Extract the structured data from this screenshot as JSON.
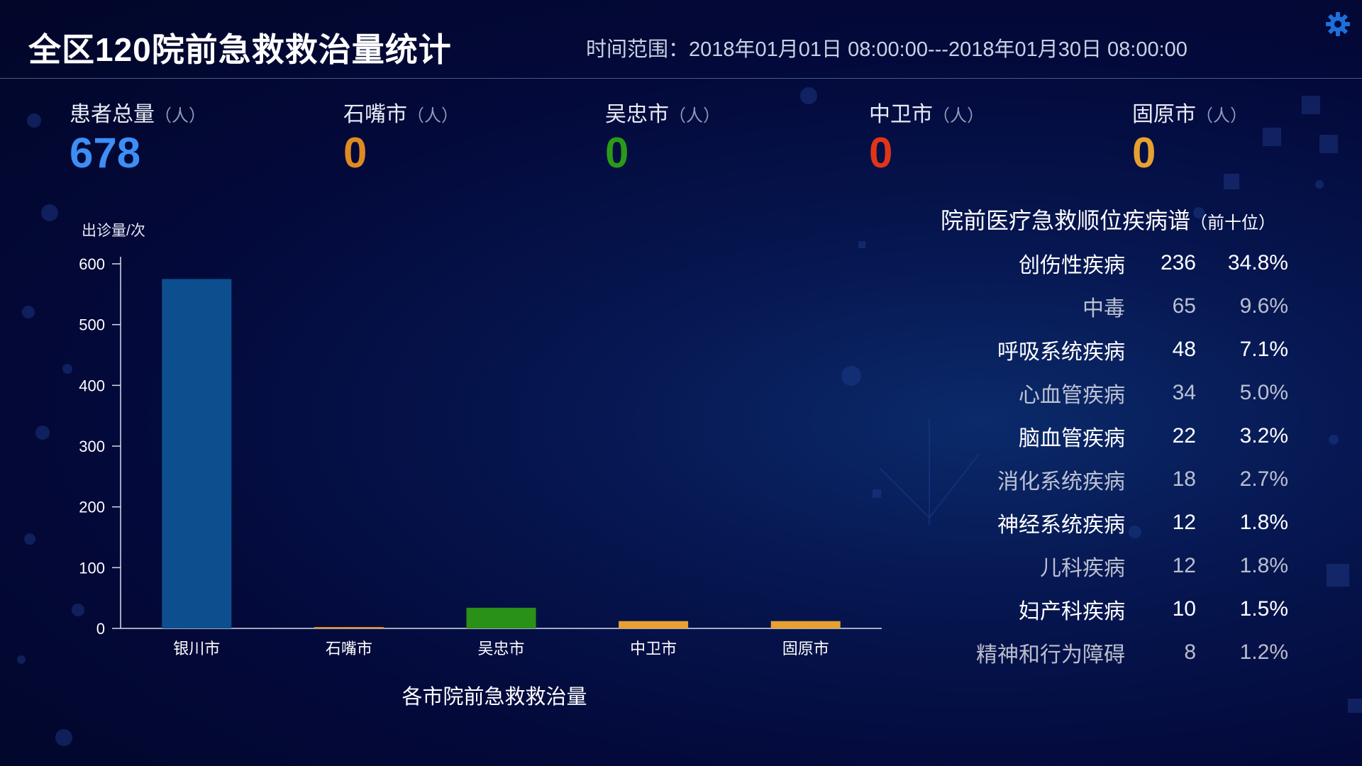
{
  "header": {
    "title": "全区120院前急救救治量统计",
    "time_range": "时间范围：2018年01月01日 08:00:00---2018年01月30日 08:00:00",
    "settings_icon": "gear-icon",
    "settings_color": "#1e6fd9"
  },
  "stats": [
    {
      "label": "患者总量",
      "unit": "（人）",
      "value": "678",
      "color": "#3d8ef5"
    },
    {
      "label": "石嘴市",
      "unit": "（人）",
      "value": "0",
      "color": "#e08a22"
    },
    {
      "label": "吴忠市",
      "unit": "（人）",
      "value": "0",
      "color": "#2a9a18"
    },
    {
      "label": "中卫市",
      "unit": "（人）",
      "value": "0",
      "color": "#e03518"
    },
    {
      "label": "固原市",
      "unit": "（人）",
      "value": "0",
      "color": "#e8a030"
    }
  ],
  "chart_data": {
    "type": "bar",
    "title": "各市院前急救救治量",
    "xlabel": "",
    "ylabel": "出诊量/次",
    "categories": [
      "银川市",
      "石嘴市",
      "吴忠市",
      "中卫市",
      "固原市"
    ],
    "values": [
      575,
      2,
      34,
      12,
      12
    ],
    "colors": [
      "#0d4f8e",
      "#e08a22",
      "#2a9018",
      "#e8a030",
      "#e8a030"
    ],
    "ylim": [
      0,
      600
    ],
    "yticks": [
      0,
      100,
      200,
      300,
      400,
      500,
      600
    ],
    "grid": false,
    "legend": "none"
  },
  "ranking": {
    "title": "院前医疗急救顺位疾病谱",
    "subtitle": "（前十位）",
    "rows": [
      {
        "name": "创伤性疾病",
        "count": "236",
        "percent": "34.8%"
      },
      {
        "name": "中毒",
        "count": "65",
        "percent": "9.6%"
      },
      {
        "name": "呼吸系统疾病",
        "count": "48",
        "percent": "7.1%"
      },
      {
        "name": "心血管疾病",
        "count": "34",
        "percent": "5.0%"
      },
      {
        "name": "脑血管疾病",
        "count": "22",
        "percent": "3.2%"
      },
      {
        "name": "消化系统疾病",
        "count": "18",
        "percent": "2.7%"
      },
      {
        "name": "神经系统疾病",
        "count": "12",
        "percent": "1.8%"
      },
      {
        "name": "儿科疾病",
        "count": "12",
        "percent": "1.8%"
      },
      {
        "name": "妇产科疾病",
        "count": "10",
        "percent": "1.5%"
      },
      {
        "name": "精神和行为障碍",
        "count": "8",
        "percent": "1.2%"
      }
    ]
  }
}
